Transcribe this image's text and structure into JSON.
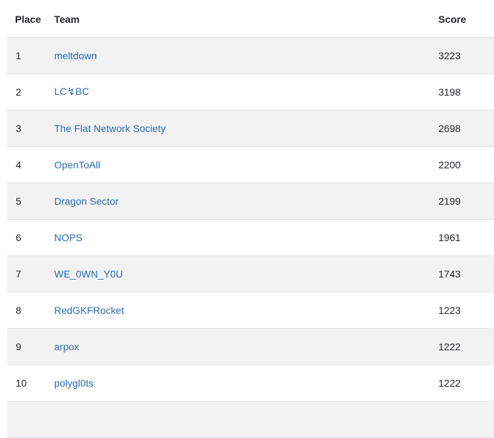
{
  "headers": {
    "place": "Place",
    "team": "Team",
    "score": "Score"
  },
  "rows": [
    {
      "place": "1",
      "team": "meltdown",
      "score": "3223"
    },
    {
      "place": "2",
      "team": "LC↯BC",
      "score": "3198"
    },
    {
      "place": "3",
      "team": "The Flat Network Society",
      "score": "2698"
    },
    {
      "place": "4",
      "team": "OpenToAll",
      "score": "2200"
    },
    {
      "place": "5",
      "team": "Dragon Sector",
      "score": "2199"
    },
    {
      "place": "6",
      "team": "NOPS",
      "score": "1961"
    },
    {
      "place": "7",
      "team": "WE_0WN_Y0U",
      "score": "1743"
    },
    {
      "place": "8",
      "team": "RedGKFRocket",
      "score": "1223"
    },
    {
      "place": "9",
      "team": "arpox",
      "score": "1222"
    },
    {
      "place": "10",
      "team": "polygl0ts",
      "score": "1222"
    }
  ],
  "colors": {
    "link": "#2b6cb0",
    "stripe": "#f2f2f2",
    "border": "#dee2e6",
    "text": "#212529"
  }
}
